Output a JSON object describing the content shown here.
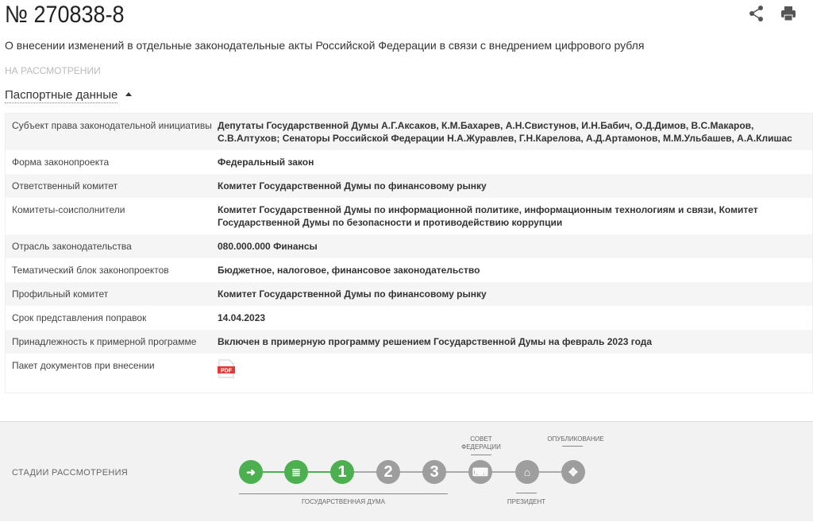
{
  "header": {
    "title": "№ 270838-8",
    "subtitle": "О внесении изменений в отдельные законодательные акты Российской Федерации в связи с внедрением цифрового рубля",
    "status": "НА РАССМОТРЕНИИ",
    "share_icon": "share-icon",
    "print_icon": "print-icon"
  },
  "passport": {
    "toggle_label": "Паспортные данные",
    "rows": [
      {
        "key": "Субъект права законодательной инициативы",
        "value": "Депутаты Государственной Думы А.Г.Аксаков, К.М.Бахарев, А.Н.Свистунов, И.Н.Бабич, О.Д.Димов, В.С.Макаров, С.В.Алтухов; Сенаторы Российской Федерации Н.А.Журавлев, Г.Н.Карелова, А.Д.Артамонов, М.М.Ульбашев, А.А.Клишас"
      },
      {
        "key": "Форма законопроекта",
        "value": "Федеральный закон"
      },
      {
        "key": "Ответственный комитет",
        "value": "Комитет Государственной Думы по финансовому рынку"
      },
      {
        "key": "Комитеты-соисполнители",
        "value": "Комитет Государственной Думы по информационной политике, информационным технологиям и связи, Комитет Государственной Думы по безопасности и противодействию коррупции"
      },
      {
        "key": "Отрасль законодательства",
        "value": "080.000.000 Финансы"
      },
      {
        "key": "Тематический блок законопроектов",
        "value": "Бюджетное, налоговое, финансовое законодательство"
      },
      {
        "key": "Профильный комитет",
        "value": "Комитет Государственной Думы по финансовому рынку"
      },
      {
        "key": "Срок представления поправок",
        "value": "14.04.2023"
      },
      {
        "key": "Принадлежность к примерной программе",
        "value": "Включен в примерную программу решением Государственной Думы на февраль 2023 года"
      },
      {
        "key": "Пакет документов при внесении",
        "value": ""
      }
    ],
    "pdf_label": "PDF"
  },
  "stages": {
    "label": "СТАДИИ РАССМОТРЕНИЯ",
    "duma": "ГОСУДАРСТВЕННАЯ ДУМА",
    "council": "СОВЕТ ФЕДЕРАЦИИ",
    "president": "ПРЕЗИДЕНТ",
    "publication": "ОПУБЛИКОВАНИЕ",
    "nodes": [
      {
        "text": "➜",
        "done": true
      },
      {
        "text": "≣",
        "done": true
      },
      {
        "text": "1",
        "done": true
      },
      {
        "text": "2",
        "done": false
      },
      {
        "text": "3",
        "done": false
      },
      {
        "text": "⌨",
        "done": false
      },
      {
        "text": "⌂",
        "done": false
      },
      {
        "text": "✥",
        "done": false
      }
    ],
    "colors": {
      "done": "#4caf50",
      "pending": "#9e9e9e"
    }
  }
}
